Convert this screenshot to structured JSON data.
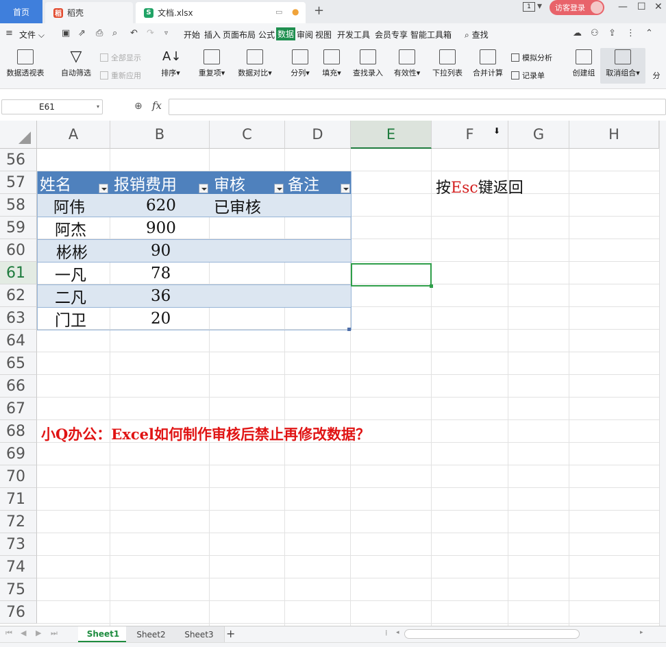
{
  "titlebar": {
    "home_tab": "首页",
    "tab_daoke": "稻壳",
    "tab_file": "文档.xlsx",
    "login_label": "访客登录",
    "badge": "1",
    "plus": "+",
    "minimize": "—",
    "restore": "☐",
    "close": "✕"
  },
  "menubar": {
    "file": "文件",
    "items": [
      "开始",
      "插入",
      "页面布局",
      "公式",
      "数据",
      "审阅",
      "视图",
      "开发工具",
      "会员专享",
      "智能工具箱"
    ],
    "active": "数据",
    "search": "查找"
  },
  "ribbon": {
    "pivot": "数据透视表",
    "autofilter": "自动筛选",
    "show_all": "全部显示",
    "reapply": "重新应用",
    "sort": "排序",
    "duplicates": "重复项",
    "compare": "数据对比",
    "split": "分列",
    "fill": "填充",
    "lookup": "查找录入",
    "validity": "有效性",
    "dropdown": "下拉列表",
    "consolidate": "合并计算",
    "simulate": "模拟分析",
    "record": "记录单",
    "create_group": "创建组",
    "ungroup": "取消组合",
    "more": "分"
  },
  "formula_bar": {
    "cell_ref": "E61",
    "fx": "fx",
    "value": ""
  },
  "grid": {
    "columns": [
      "A",
      "B",
      "C",
      "D",
      "E",
      "F",
      "G",
      "H"
    ],
    "selected_column": "E",
    "rows": [
      "56",
      "57",
      "58",
      "59",
      "60",
      "61",
      "62",
      "63",
      "64",
      "65",
      "66",
      "67",
      "68",
      "69",
      "70",
      "71",
      "72",
      "73",
      "74",
      "75",
      "76"
    ],
    "selected_row": "61"
  },
  "table": {
    "headers": [
      "姓名",
      "报销费用",
      "审核",
      "备注"
    ],
    "rows": [
      {
        "name": "阿伟",
        "amount": "620",
        "audit": "已审核",
        "note": ""
      },
      {
        "name": "阿杰",
        "amount": "900",
        "audit": "",
        "note": ""
      },
      {
        "name": "彬彬",
        "amount": "90",
        "audit": "",
        "note": ""
      },
      {
        "name": "一凡",
        "amount": "78",
        "audit": "",
        "note": ""
      },
      {
        "name": "二凡",
        "amount": "36",
        "audit": "",
        "note": ""
      },
      {
        "name": "门卫",
        "amount": "20",
        "audit": "",
        "note": ""
      }
    ]
  },
  "note": {
    "prefix": "按",
    "key": "Esc",
    "suffix": "键返回"
  },
  "title_text": "小Q办公：Excel如何制作审核后禁止再修改数据？",
  "sheets": [
    "Sheet1",
    "Sheet2",
    "Sheet3"
  ],
  "active_sheet": "Sheet1",
  "colors": {
    "accent": "#1f8f4f",
    "table_header": "#4f81bd",
    "table_band": "#dce6f1",
    "title_red": "#e01414",
    "selection": "#2e9e49"
  }
}
